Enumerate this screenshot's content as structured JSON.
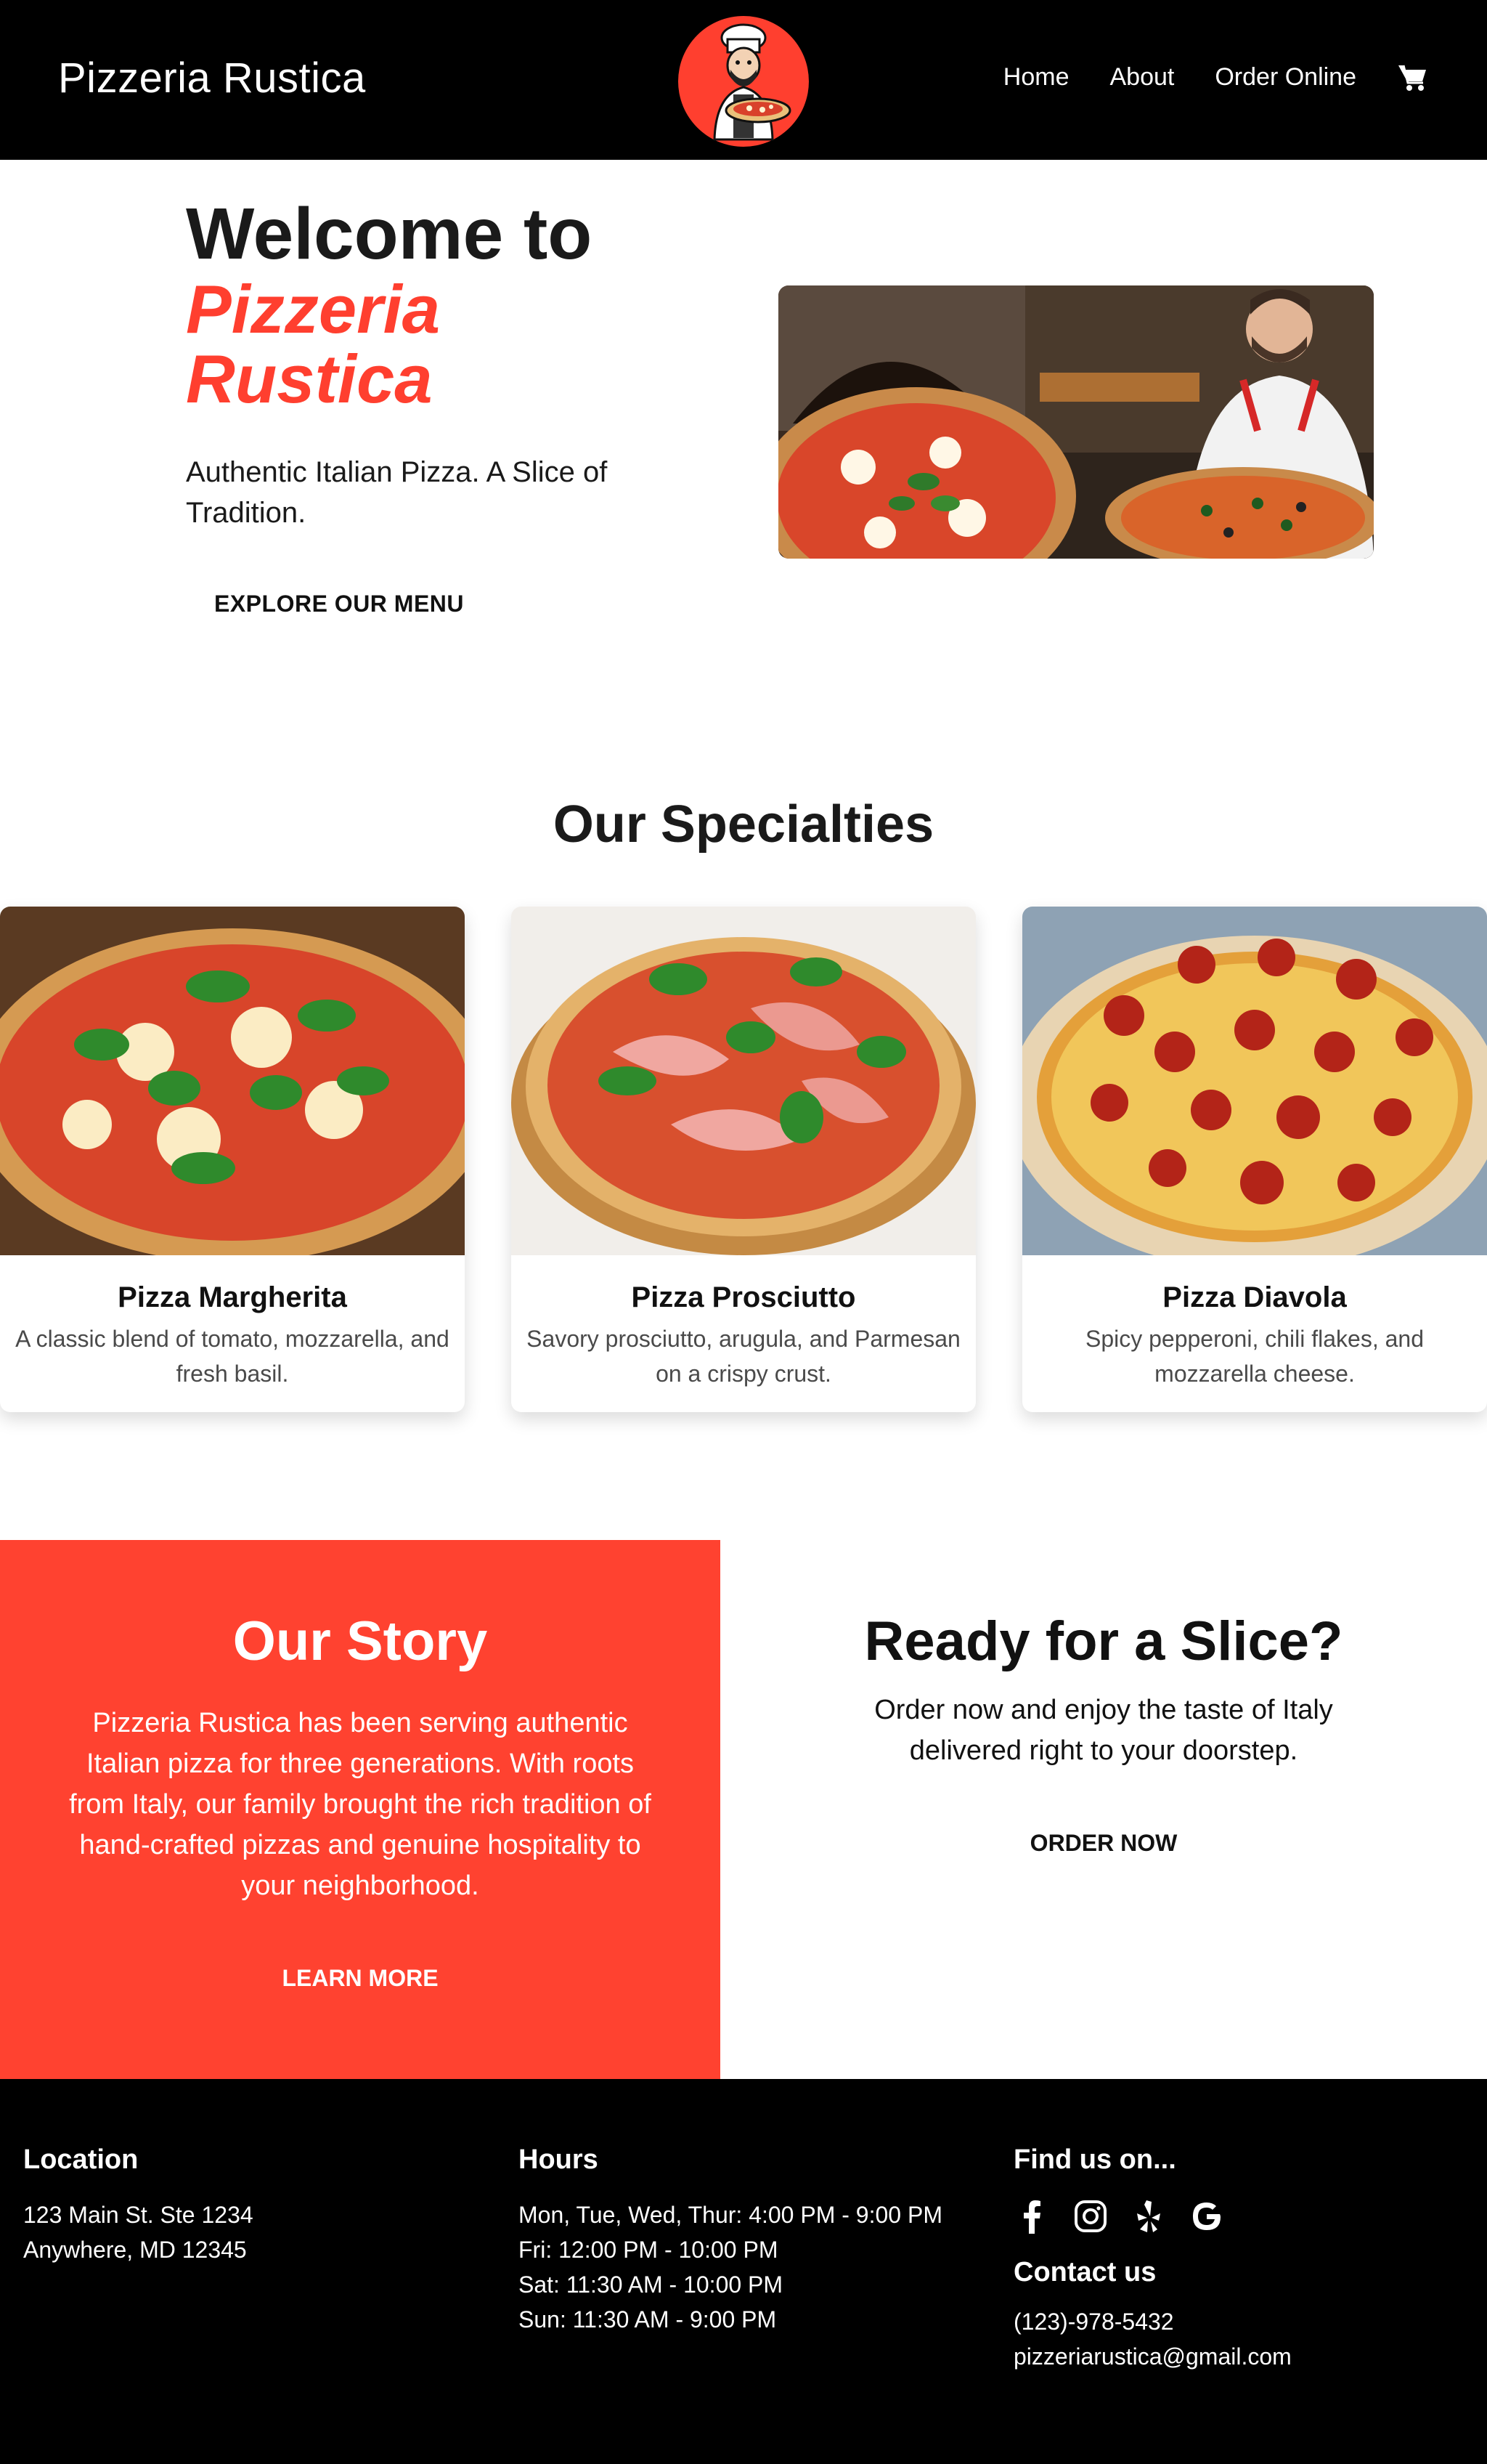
{
  "header": {
    "brand": "Pizzeria Rustica",
    "nav": [
      "Home",
      "About",
      "Order Online"
    ],
    "cart_icon": "shopping-cart-icon",
    "logo_icon": "chef-mascot-logo"
  },
  "hero": {
    "title": "Welcome to",
    "accent": "Pizzeria Rustica",
    "subtitle": "Authentic Italian Pizza. A Slice of Tradition.",
    "cta": "EXPLORE OUR MENU"
  },
  "specialties": {
    "title": "Our Specialties",
    "items": [
      {
        "name": "Pizza Margherita",
        "description": "A classic blend of tomato, mozzarella, and fresh basil."
      },
      {
        "name": "Pizza Prosciutto",
        "description": "Savory prosciutto, arugula, and Parmesan on a crispy crust."
      },
      {
        "name": "Pizza Diavola",
        "description": "Spicy pepperoni, chili flakes, and mozzarella cheese."
      }
    ]
  },
  "story": {
    "title": "Our Story",
    "text": "Pizzeria Rustica has been serving authentic Italian pizza for three generations. With roots from Italy, our family brought the rich tradition of hand-crafted pizzas and genuine hospitality to your neighborhood.",
    "cta": "LEARN MORE"
  },
  "order": {
    "title": "Ready for a Slice?",
    "text": "Order now and enjoy the taste of Italy delivered right to your doorstep.",
    "cta": "ORDER NOW"
  },
  "footer": {
    "location": {
      "heading": "Location",
      "lines": [
        "123 Main St. Ste 1234",
        "Anywhere, MD 12345"
      ]
    },
    "hours": {
      "heading": "Hours",
      "lines": [
        "Mon, Tue, Wed, Thur: 4:00 PM - 9:00 PM",
        "Fri: 12:00 PM - 10:00 PM",
        "Sat: 11:30 AM - 10:00 PM",
        "Sun: 11:30 AM - 9:00 PM"
      ]
    },
    "find": {
      "heading": "Find us on...",
      "icons": [
        "facebook-icon",
        "instagram-icon",
        "yelp-icon",
        "google-icon"
      ]
    },
    "contact": {
      "heading": "Contact us",
      "phone": "(123)-978-5432",
      "email": "pizzeriarustica@gmail.com"
    }
  },
  "colors": {
    "accent": "#ff4230",
    "header_bg": "#000000",
    "footer_bg": "#000000"
  }
}
